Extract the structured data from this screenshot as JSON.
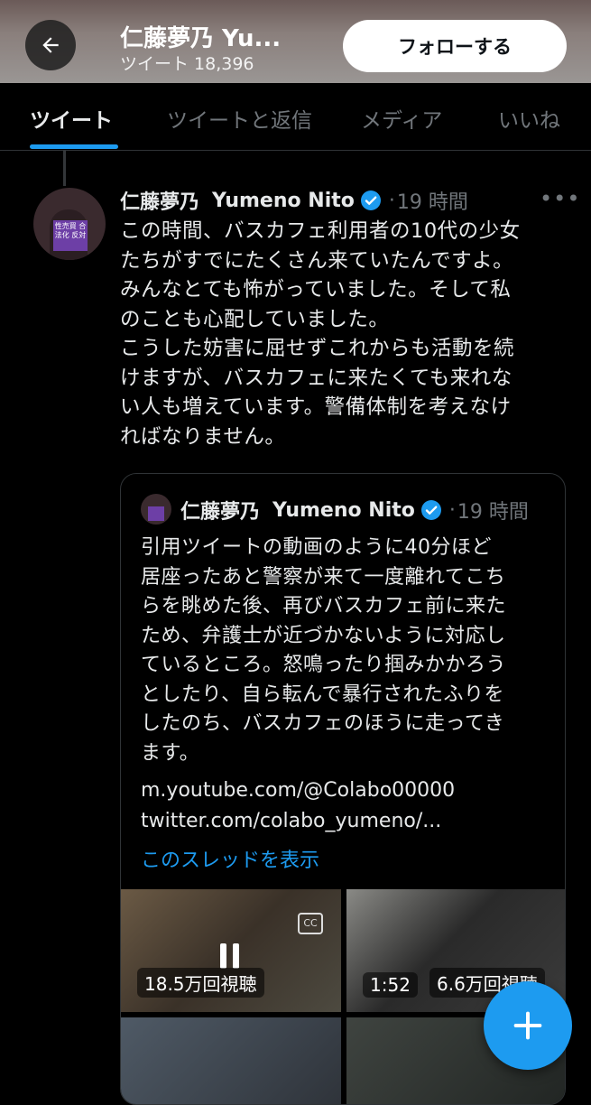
{
  "header": {
    "name": "仁藤夢乃  Yu...",
    "tweet_count": "ツイート 18,396",
    "follow_label": "フォローする"
  },
  "tabs": [
    {
      "label": "ツイート",
      "active": true
    },
    {
      "label": "ツイートと返信",
      "active": false
    },
    {
      "label": "メディア",
      "active": false
    },
    {
      "label": "いいね",
      "active": false
    }
  ],
  "avatar": {
    "sign_text": "性売買 合法化 反対"
  },
  "tweet": {
    "display_name": "仁藤夢乃",
    "handle_name": "Yumeno Nito",
    "dot": "·",
    "time": "19 時間",
    "text": "この時間、バスカフェ利用者の10代の少女\nたちがすでにたくさん来ていたんですよ。\nみんなとても怖がっていました。そして私\nのことも心配していました。\nこうした妨害に屈せずこれからも活動を続\nけますが、バスカフェに来たくても来れな\nい人も増えています。警備体制を考えなけ\nればなりません。"
  },
  "quote": {
    "display_name": "仁藤夢乃",
    "handle_name": "Yumeno Nito",
    "dot": "·",
    "time": "19 時間",
    "text": "引用ツイートの動画のように40分ほど\n居座ったあと警察が来て一度離れてこち\nらを眺めた後、再びバスカフェ前に来た\nため、弁護士が近づかないように対応し\nているところ。怒鳴ったり掴みかかろう\nとしたり、自ら転んで暴行されたふりを\nしたのち、バスカフェのほうに走ってき\nます。",
    "link1": "m.youtube.com/@Colabo00000",
    "link2": "twitter.com/colabo_yumeno/...",
    "show_thread": "このスレッドを表示",
    "media": [
      {
        "label": "18.5万回視聴",
        "cc": "CC"
      },
      {
        "label": "1:52",
        "views": "6.6万回視聴"
      }
    ]
  },
  "colors": {
    "accent": "#1d9bf0",
    "background": "#000000",
    "text": "#e7e9ea",
    "muted": "#71767b",
    "border": "#2f3336"
  },
  "icons": [
    "arrow-left-icon",
    "verified-badge-icon",
    "more-dots-icon",
    "closed-caption-icon",
    "pause-icon",
    "plus-icon"
  ]
}
